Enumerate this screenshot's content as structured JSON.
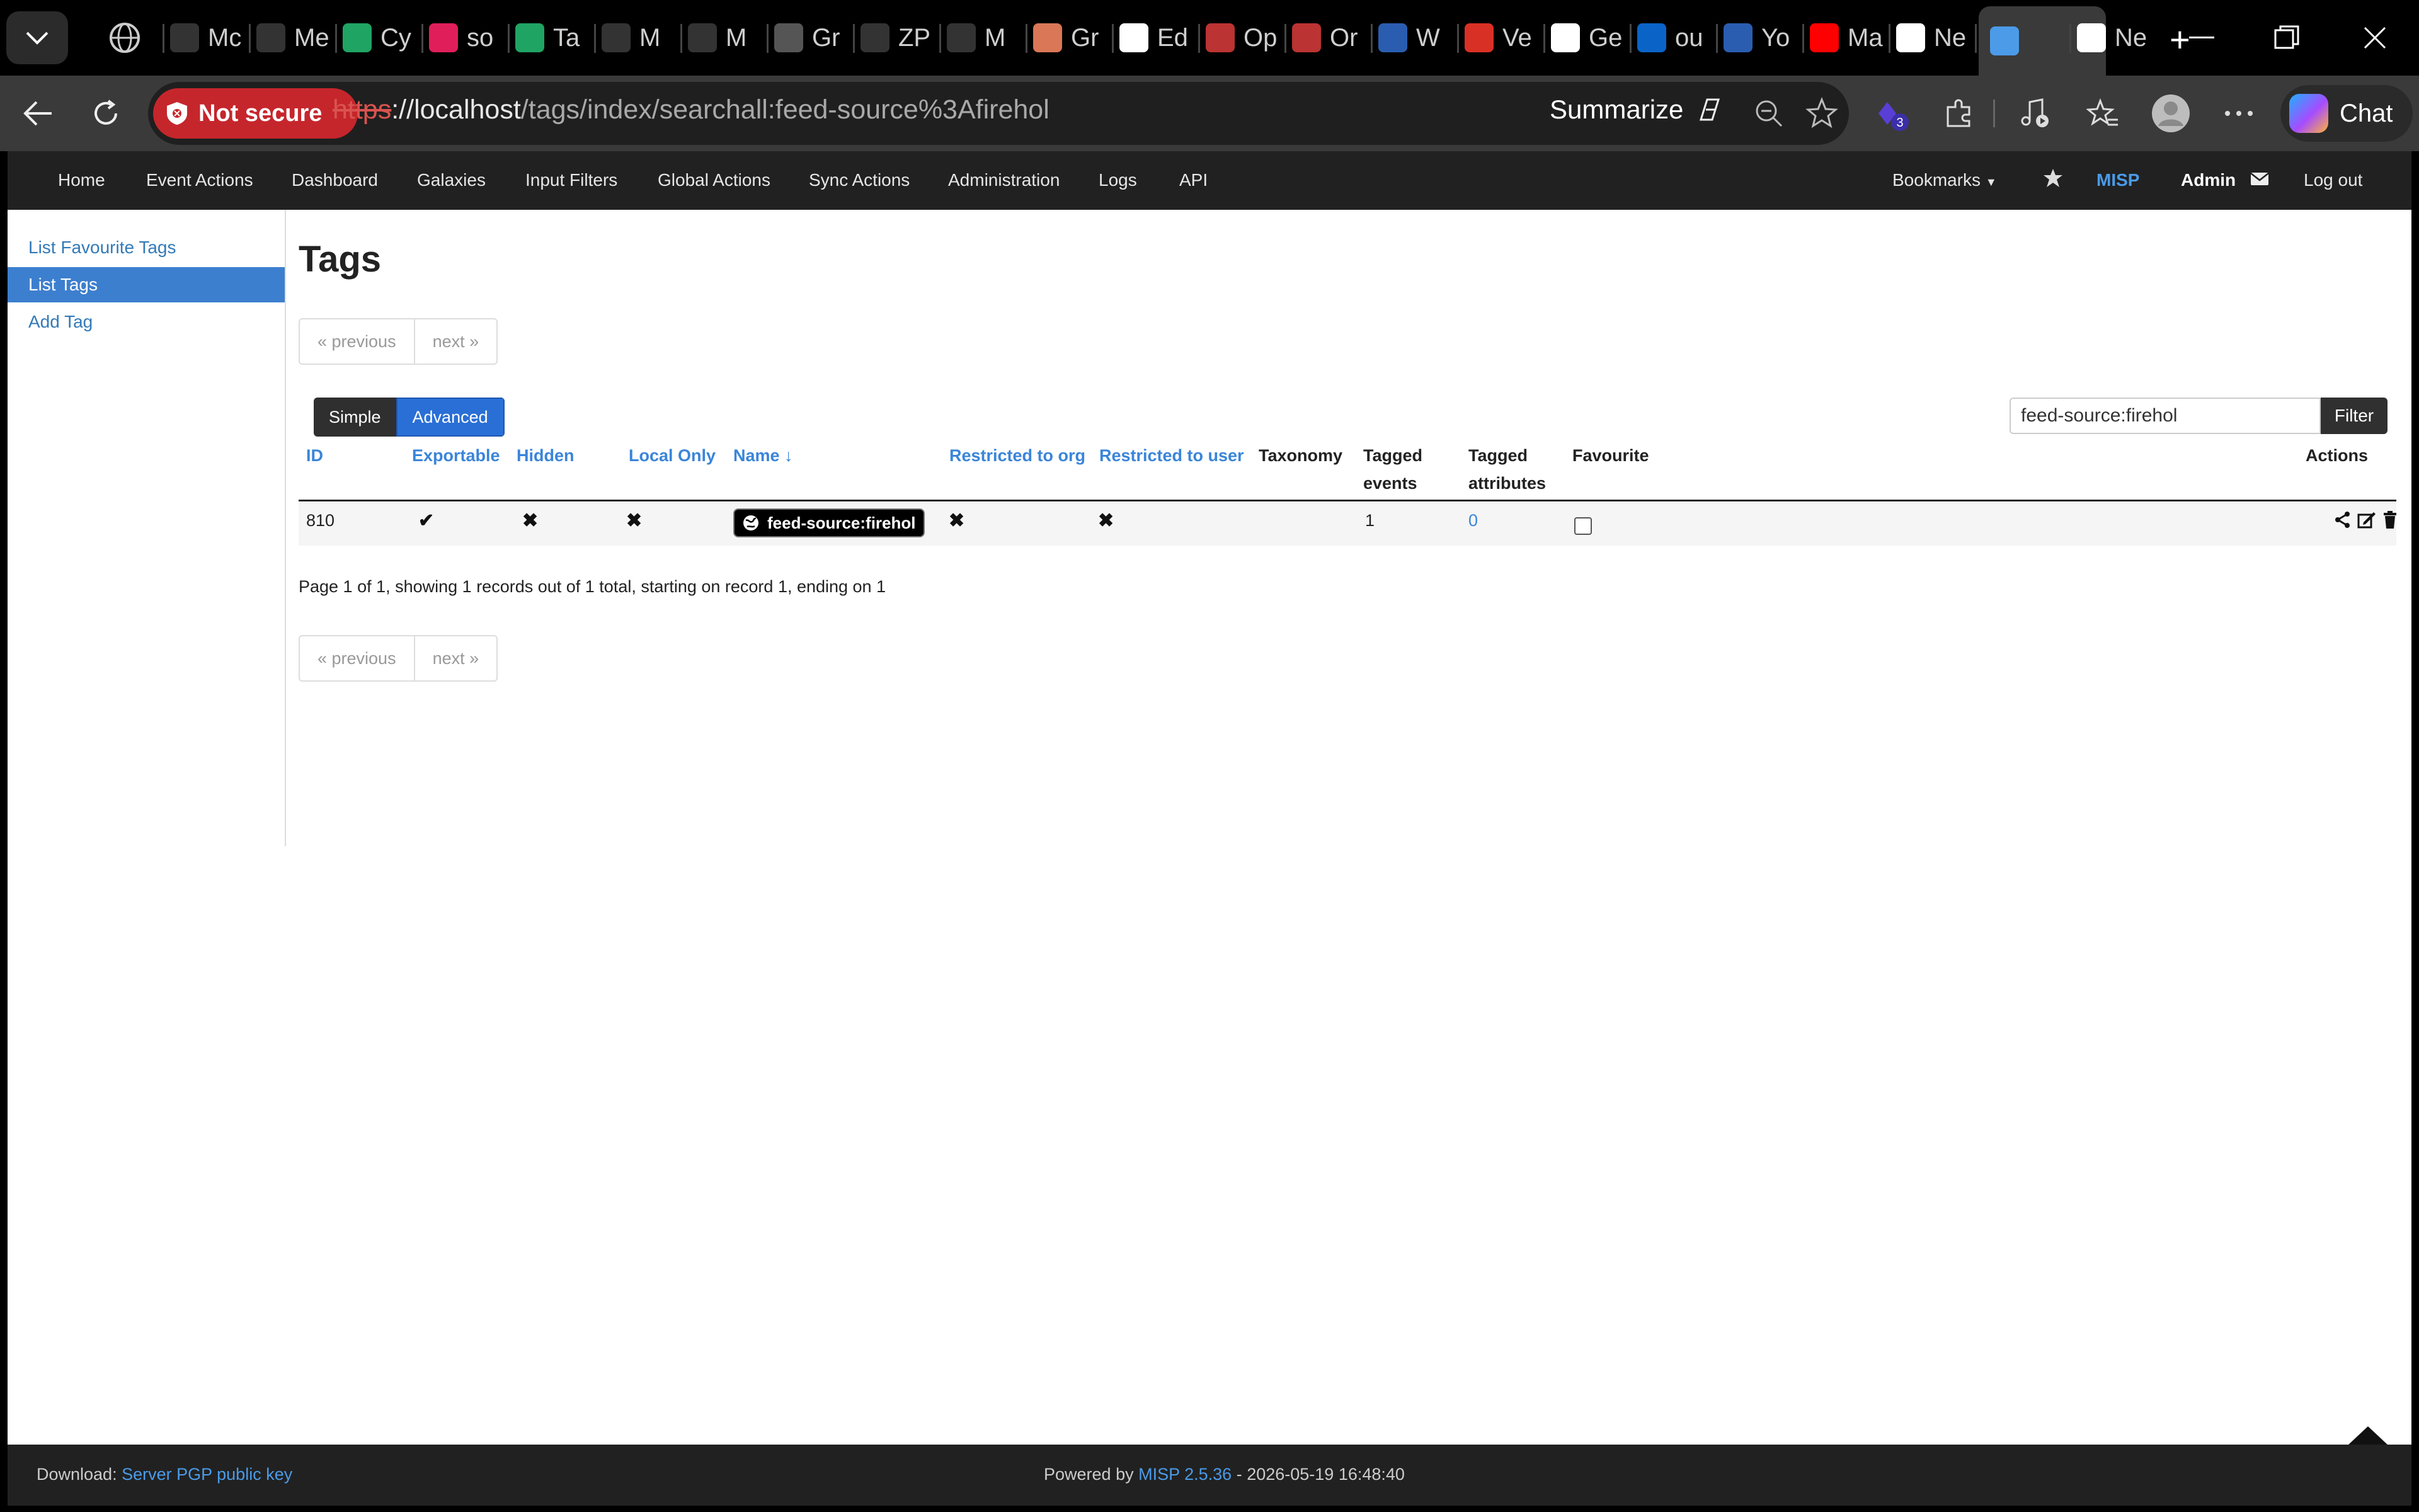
{
  "browser": {
    "tabs": [
      {
        "icon": "mc-icon",
        "label": "Mc",
        "color": "#333"
      },
      {
        "icon": "mc-icon",
        "label": "Me",
        "color": "#333"
      },
      {
        "icon": "drive-icon",
        "label": "Cy",
        "color": "#1fa463"
      },
      {
        "icon": "slack-icon",
        "label": "so",
        "color": "#e01e5a"
      },
      {
        "icon": "drive-icon",
        "label": "Ta",
        "color": "#1fa463"
      },
      {
        "icon": "mc-icon",
        "label": "M",
        "color": "#333"
      },
      {
        "icon": "mc-icon",
        "label": "M",
        "color": "#333"
      },
      {
        "icon": "openai-icon",
        "label": "Gr",
        "color": "#555"
      },
      {
        "icon": "mc-icon",
        "label": "ZP",
        "color": "#333"
      },
      {
        "icon": "circle-slash-icon",
        "label": "M",
        "color": "#333"
      },
      {
        "icon": "claude-icon",
        "label": "Gr",
        "color": "#d97757"
      },
      {
        "icon": "github-icon",
        "label": "Ed",
        "color": "#fff"
      },
      {
        "icon": "pdf-icon",
        "label": "Op",
        "color": "#b33"
      },
      {
        "icon": "pdf-icon",
        "label": "Or",
        "color": "#b33"
      },
      {
        "icon": "search-icon",
        "label": "W",
        "color": "#2a5db0"
      },
      {
        "icon": "gmail-icon",
        "label": "Ve",
        "color": "#d93025"
      },
      {
        "icon": "notion-icon",
        "label": "Ge",
        "color": "#fff"
      },
      {
        "icon": "outlook-icon",
        "label": "ou",
        "color": "#0a64c8"
      },
      {
        "icon": "search-icon",
        "label": "Yo",
        "color": "#2a5db0"
      },
      {
        "icon": "youtube-icon",
        "label": "Ma",
        "color": "#ff0000"
      },
      {
        "icon": "newtab-icon",
        "label": "Ne",
        "color": "#fff"
      },
      {
        "icon": "misp-icon",
        "label": "",
        "color": "#4b9be8",
        "active": true
      },
      {
        "icon": "newtab-icon",
        "label": "Ne",
        "color": "#fff"
      }
    ],
    "security_label": "Not secure",
    "url_protocol": "https",
    "url_rest": "://localhost",
    "url_path": "/tags/index/searchall:feed-source%3Afirehol",
    "summarize_label": "Summarize",
    "chat_label": "Chat",
    "extension_badge": "3"
  },
  "nav": {
    "items": [
      "Home",
      "Event Actions",
      "Dashboard",
      "Galaxies",
      "Input Filters",
      "Global Actions",
      "Sync Actions",
      "Administration",
      "Logs",
      "API"
    ],
    "bookmarks": "Bookmarks",
    "brand": "MISP",
    "user": "Admin",
    "logout": "Log out"
  },
  "sidebar": {
    "items": [
      {
        "label": "List Favourite Tags",
        "active": false
      },
      {
        "label": "List Tags",
        "active": true
      },
      {
        "label": "Add Tag",
        "active": false
      }
    ]
  },
  "main": {
    "title": "Tags",
    "pager": {
      "previous": "« previous",
      "next": "next »"
    },
    "view_toggle": {
      "simple": "Simple",
      "advanced": "Advanced"
    },
    "search_value": "feed-source:firehol",
    "filter_label": "Filter",
    "columns": {
      "id": "ID",
      "exportable": "Exportable",
      "hidden": "Hidden",
      "local_only": "Local Only",
      "name": "Name ↓",
      "restricted_org": "Restricted to org",
      "restricted_user": "Restricted to user",
      "taxonomy": "Taxonomy",
      "tagged_events_1": "Tagged",
      "tagged_events_2": "events",
      "tagged_attributes_1": "Tagged",
      "tagged_attributes_2": "attributes",
      "favourite": "Favourite",
      "actions": "Actions"
    },
    "rows": [
      {
        "id": "810",
        "exportable": "✔",
        "hidden": "✖",
        "local_only": "✖",
        "name": "feed-source:firehol",
        "restricted_org": "✖",
        "restricted_user": "✖",
        "taxonomy": "",
        "tagged_events": "1",
        "tagged_attributes": "0",
        "favourite": false
      }
    ],
    "summary": "Page 1 of 1, showing 1 records out of 1 total, starting on record 1, ending on 1"
  },
  "footer": {
    "download_label": "Download:",
    "download_link": "Server PGP public key",
    "powered_label": "Powered by",
    "version_link": "MISP 2.5.36",
    "timestamp": "- 2026-05-19 16:48:40"
  }
}
